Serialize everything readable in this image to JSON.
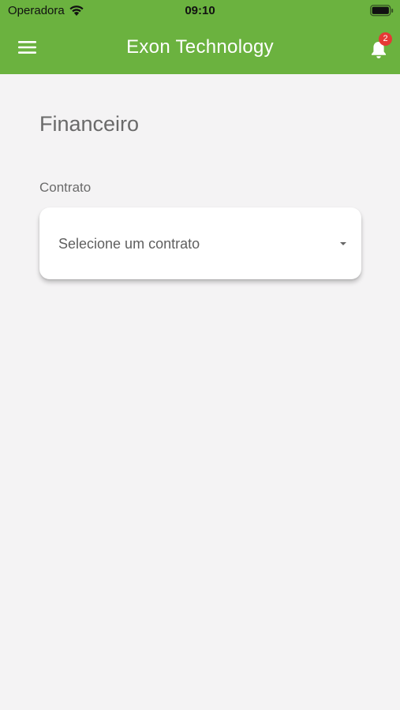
{
  "status_bar": {
    "carrier": "Operadora",
    "time": "09:10",
    "wifi_icon": "wifi-icon",
    "battery_icon": "battery-icon"
  },
  "app_bar": {
    "title": "Exon Technology",
    "menu_icon": "hamburger-menu-icon",
    "notification_icon": "bell-icon",
    "notification_count": "2",
    "background_color": "#6bb23f"
  },
  "page": {
    "title": "Financeiro",
    "contract_field": {
      "label": "Contrato",
      "placeholder": "Selecione um contrato",
      "dropdown_icon": "caret-down-icon"
    }
  }
}
